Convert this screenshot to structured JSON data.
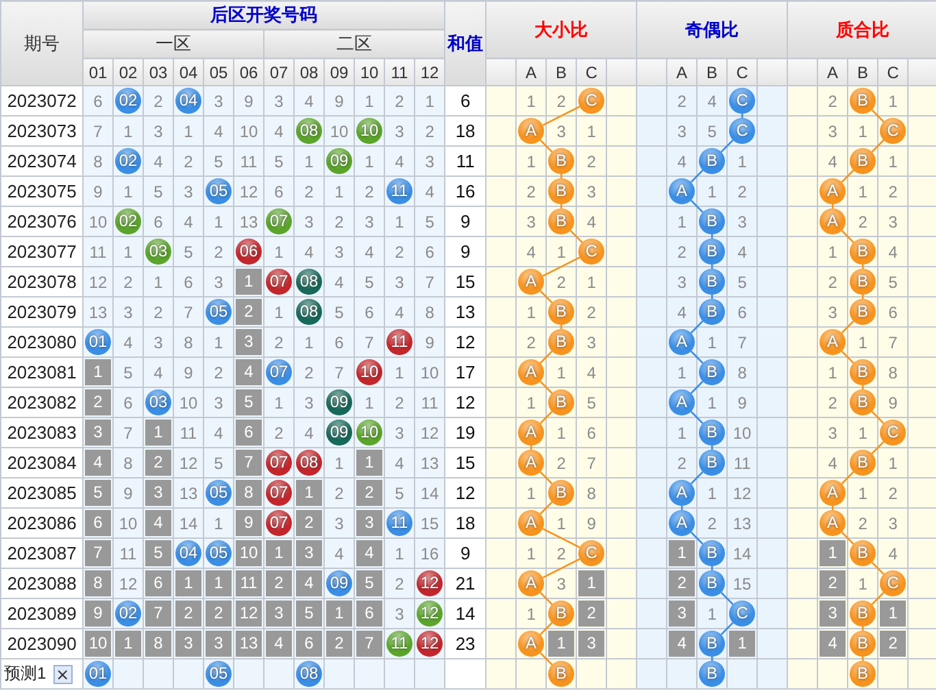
{
  "header": {
    "period": "期号",
    "group": "后区开奖号码",
    "zones": [
      {
        "label": "一区"
      },
      {
        "label": "二区"
      }
    ],
    "columns": [
      "01",
      "02",
      "03",
      "04",
      "05",
      "06",
      "07",
      "08",
      "09",
      "10",
      "11",
      "12"
    ],
    "sum": "和值"
  },
  "sections": [
    {
      "title": "大小比",
      "color": "#f7931e",
      "columns": [
        "A",
        "B",
        "C"
      ]
    },
    {
      "title": "奇偶比",
      "color": "#3a8ee6",
      "columns": [
        "A",
        "B",
        "C"
      ]
    },
    {
      "title": "质合比",
      "color": "#f7931e",
      "columns": [
        "A",
        "B",
        "C"
      ]
    }
  ],
  "rows": [
    {
      "period": "2023072",
      "cells": [
        {
          "kind": "miss",
          "text": "6"
        },
        {
          "kind": "ball",
          "text": "02",
          "color": "#3a8ee6"
        },
        {
          "kind": "miss",
          "text": "2"
        },
        {
          "kind": "ball",
          "text": "04",
          "color": "#3a8ee6"
        },
        {
          "kind": "miss",
          "text": "3"
        },
        {
          "kind": "miss",
          "text": "9"
        },
        {
          "kind": "miss",
          "text": "3"
        },
        {
          "kind": "miss",
          "text": "4"
        },
        {
          "kind": "miss",
          "text": "9"
        },
        {
          "kind": "miss",
          "text": "1"
        },
        {
          "kind": "miss",
          "text": "2"
        },
        {
          "kind": "miss",
          "text": "1"
        }
      ],
      "sum": "6",
      "ratios": [
        [
          {
            "kind": "miss",
            "text": "1"
          },
          {
            "kind": "miss",
            "text": "2"
          },
          {
            "kind": "ball",
            "text": "C"
          }
        ],
        [
          {
            "kind": "miss",
            "text": "2"
          },
          {
            "kind": "miss",
            "text": "4"
          },
          {
            "kind": "ball",
            "text": "C"
          }
        ],
        [
          {
            "kind": "miss",
            "text": "2"
          },
          {
            "kind": "ball",
            "text": "B"
          },
          {
            "kind": "miss",
            "text": "1"
          }
        ]
      ]
    },
    {
      "period": "2023073",
      "cells": [
        {
          "kind": "miss",
          "text": "7"
        },
        {
          "kind": "miss",
          "text": "1"
        },
        {
          "kind": "miss",
          "text": "3"
        },
        {
          "kind": "miss",
          "text": "1"
        },
        {
          "kind": "miss",
          "text": "4"
        },
        {
          "kind": "miss",
          "text": "10"
        },
        {
          "kind": "miss",
          "text": "4"
        },
        {
          "kind": "ball",
          "text": "08",
          "color": "#5ba52b"
        },
        {
          "kind": "miss",
          "text": "10"
        },
        {
          "kind": "ball",
          "text": "10",
          "color": "#5ba52b"
        },
        {
          "kind": "miss",
          "text": "3"
        },
        {
          "kind": "miss",
          "text": "2"
        }
      ],
      "sum": "18",
      "ratios": [
        [
          {
            "kind": "ball",
            "text": "A"
          },
          {
            "kind": "miss",
            "text": "3"
          },
          {
            "kind": "miss",
            "text": "1"
          }
        ],
        [
          {
            "kind": "miss",
            "text": "3"
          },
          {
            "kind": "miss",
            "text": "5"
          },
          {
            "kind": "ball",
            "text": "C"
          }
        ],
        [
          {
            "kind": "miss",
            "text": "3"
          },
          {
            "kind": "miss",
            "text": "1"
          },
          {
            "kind": "ball",
            "text": "C"
          }
        ]
      ]
    },
    {
      "period": "2023074",
      "cells": [
        {
          "kind": "miss",
          "text": "8"
        },
        {
          "kind": "ball",
          "text": "02",
          "color": "#3a8ee6"
        },
        {
          "kind": "miss",
          "text": "4"
        },
        {
          "kind": "miss",
          "text": "2"
        },
        {
          "kind": "miss",
          "text": "5"
        },
        {
          "kind": "miss",
          "text": "11"
        },
        {
          "kind": "miss",
          "text": "5"
        },
        {
          "kind": "miss",
          "text": "1"
        },
        {
          "kind": "ball",
          "text": "09",
          "color": "#5ba52b"
        },
        {
          "kind": "miss",
          "text": "1"
        },
        {
          "kind": "miss",
          "text": "4"
        },
        {
          "kind": "miss",
          "text": "3"
        }
      ],
      "sum": "11",
      "ratios": [
        [
          {
            "kind": "miss",
            "text": "1"
          },
          {
            "kind": "ball",
            "text": "B"
          },
          {
            "kind": "miss",
            "text": "2"
          }
        ],
        [
          {
            "kind": "miss",
            "text": "4"
          },
          {
            "kind": "ball",
            "text": "B"
          },
          {
            "kind": "miss",
            "text": "1"
          }
        ],
        [
          {
            "kind": "miss",
            "text": "4"
          },
          {
            "kind": "ball",
            "text": "B"
          },
          {
            "kind": "miss",
            "text": "1"
          }
        ]
      ]
    },
    {
      "period": "2023075",
      "cells": [
        {
          "kind": "miss",
          "text": "9"
        },
        {
          "kind": "miss",
          "text": "1"
        },
        {
          "kind": "miss",
          "text": "5"
        },
        {
          "kind": "miss",
          "text": "3"
        },
        {
          "kind": "ball",
          "text": "05",
          "color": "#3a8ee6"
        },
        {
          "kind": "miss",
          "text": "12"
        },
        {
          "kind": "miss",
          "text": "6"
        },
        {
          "kind": "miss",
          "text": "2"
        },
        {
          "kind": "miss",
          "text": "1"
        },
        {
          "kind": "miss",
          "text": "2"
        },
        {
          "kind": "ball",
          "text": "11",
          "color": "#3a8ee6"
        },
        {
          "kind": "miss",
          "text": "4"
        }
      ],
      "sum": "16",
      "ratios": [
        [
          {
            "kind": "miss",
            "text": "2"
          },
          {
            "kind": "ball",
            "text": "B"
          },
          {
            "kind": "miss",
            "text": "3"
          }
        ],
        [
          {
            "kind": "ball",
            "text": "A"
          },
          {
            "kind": "miss",
            "text": "1"
          },
          {
            "kind": "miss",
            "text": "2"
          }
        ],
        [
          {
            "kind": "ball",
            "text": "A"
          },
          {
            "kind": "miss",
            "text": "1"
          },
          {
            "kind": "miss",
            "text": "2"
          }
        ]
      ]
    },
    {
      "period": "2023076",
      "cells": [
        {
          "kind": "miss",
          "text": "10"
        },
        {
          "kind": "ball",
          "text": "02",
          "color": "#5ba52b"
        },
        {
          "kind": "miss",
          "text": "6"
        },
        {
          "kind": "miss",
          "text": "4"
        },
        {
          "kind": "miss",
          "text": "1"
        },
        {
          "kind": "miss",
          "text": "13"
        },
        {
          "kind": "ball",
          "text": "07",
          "color": "#5ba52b"
        },
        {
          "kind": "miss",
          "text": "3"
        },
        {
          "kind": "miss",
          "text": "2"
        },
        {
          "kind": "miss",
          "text": "3"
        },
        {
          "kind": "miss",
          "text": "1"
        },
        {
          "kind": "miss",
          "text": "5"
        }
      ],
      "sum": "9",
      "ratios": [
        [
          {
            "kind": "miss",
            "text": "3"
          },
          {
            "kind": "ball",
            "text": "B"
          },
          {
            "kind": "miss",
            "text": "4"
          }
        ],
        [
          {
            "kind": "miss",
            "text": "1"
          },
          {
            "kind": "ball",
            "text": "B"
          },
          {
            "kind": "miss",
            "text": "3"
          }
        ],
        [
          {
            "kind": "ball",
            "text": "A"
          },
          {
            "kind": "miss",
            "text": "2"
          },
          {
            "kind": "miss",
            "text": "3"
          }
        ]
      ]
    },
    {
      "period": "2023077",
      "cells": [
        {
          "kind": "miss",
          "text": "11"
        },
        {
          "kind": "miss",
          "text": "1"
        },
        {
          "kind": "ball",
          "text": "03",
          "color": "#5ba52b"
        },
        {
          "kind": "miss",
          "text": "5"
        },
        {
          "kind": "miss",
          "text": "2"
        },
        {
          "kind": "ball",
          "text": "06",
          "color": "#c4262b"
        },
        {
          "kind": "miss",
          "text": "1"
        },
        {
          "kind": "miss",
          "text": "4"
        },
        {
          "kind": "miss",
          "text": "3"
        },
        {
          "kind": "miss",
          "text": "4"
        },
        {
          "kind": "miss",
          "text": "2"
        },
        {
          "kind": "miss",
          "text": "6"
        }
      ],
      "sum": "9",
      "ratios": [
        [
          {
            "kind": "miss",
            "text": "4"
          },
          {
            "kind": "miss",
            "text": "1"
          },
          {
            "kind": "ball",
            "text": "C"
          }
        ],
        [
          {
            "kind": "miss",
            "text": "2"
          },
          {
            "kind": "ball",
            "text": "B"
          },
          {
            "kind": "miss",
            "text": "4"
          }
        ],
        [
          {
            "kind": "miss",
            "text": "1"
          },
          {
            "kind": "ball",
            "text": "B"
          },
          {
            "kind": "miss",
            "text": "4"
          }
        ]
      ]
    },
    {
      "period": "2023078",
      "cells": [
        {
          "kind": "miss",
          "text": "12"
        },
        {
          "kind": "miss",
          "text": "2"
        },
        {
          "kind": "miss",
          "text": "1"
        },
        {
          "kind": "miss",
          "text": "6"
        },
        {
          "kind": "miss",
          "text": "3"
        },
        {
          "kind": "block",
          "text": "1"
        },
        {
          "kind": "ball",
          "text": "07",
          "color": "#c4262b"
        },
        {
          "kind": "ball",
          "text": "08",
          "color": "#17695a"
        },
        {
          "kind": "miss",
          "text": "4"
        },
        {
          "kind": "miss",
          "text": "5"
        },
        {
          "kind": "miss",
          "text": "3"
        },
        {
          "kind": "miss",
          "text": "7"
        }
      ],
      "sum": "15",
      "ratios": [
        [
          {
            "kind": "ball",
            "text": "A"
          },
          {
            "kind": "miss",
            "text": "2"
          },
          {
            "kind": "miss",
            "text": "1"
          }
        ],
        [
          {
            "kind": "miss",
            "text": "3"
          },
          {
            "kind": "ball",
            "text": "B"
          },
          {
            "kind": "miss",
            "text": "5"
          }
        ],
        [
          {
            "kind": "miss",
            "text": "2"
          },
          {
            "kind": "ball",
            "text": "B"
          },
          {
            "kind": "miss",
            "text": "5"
          }
        ]
      ]
    },
    {
      "period": "2023079",
      "cells": [
        {
          "kind": "miss",
          "text": "13"
        },
        {
          "kind": "miss",
          "text": "3"
        },
        {
          "kind": "miss",
          "text": "2"
        },
        {
          "kind": "miss",
          "text": "7"
        },
        {
          "kind": "ball",
          "text": "05",
          "color": "#3a8ee6"
        },
        {
          "kind": "block",
          "text": "2"
        },
        {
          "kind": "miss",
          "text": "1"
        },
        {
          "kind": "ball",
          "text": "08",
          "color": "#17695a"
        },
        {
          "kind": "miss",
          "text": "5"
        },
        {
          "kind": "miss",
          "text": "6"
        },
        {
          "kind": "miss",
          "text": "4"
        },
        {
          "kind": "miss",
          "text": "8"
        }
      ],
      "sum": "13",
      "ratios": [
        [
          {
            "kind": "miss",
            "text": "1"
          },
          {
            "kind": "ball",
            "text": "B"
          },
          {
            "kind": "miss",
            "text": "2"
          }
        ],
        [
          {
            "kind": "miss",
            "text": "4"
          },
          {
            "kind": "ball",
            "text": "B"
          },
          {
            "kind": "miss",
            "text": "6"
          }
        ],
        [
          {
            "kind": "miss",
            "text": "3"
          },
          {
            "kind": "ball",
            "text": "B"
          },
          {
            "kind": "miss",
            "text": "6"
          }
        ]
      ]
    },
    {
      "period": "2023080",
      "cells": [
        {
          "kind": "ball",
          "text": "01",
          "color": "#3a8ee6"
        },
        {
          "kind": "miss",
          "text": "4"
        },
        {
          "kind": "miss",
          "text": "3"
        },
        {
          "kind": "miss",
          "text": "8"
        },
        {
          "kind": "miss",
          "text": "1"
        },
        {
          "kind": "block",
          "text": "3"
        },
        {
          "kind": "miss",
          "text": "2"
        },
        {
          "kind": "miss",
          "text": "1"
        },
        {
          "kind": "miss",
          "text": "6"
        },
        {
          "kind": "miss",
          "text": "7"
        },
        {
          "kind": "ball",
          "text": "11",
          "color": "#c4262b"
        },
        {
          "kind": "miss",
          "text": "9"
        }
      ],
      "sum": "12",
      "ratios": [
        [
          {
            "kind": "miss",
            "text": "2"
          },
          {
            "kind": "ball",
            "text": "B"
          },
          {
            "kind": "miss",
            "text": "3"
          }
        ],
        [
          {
            "kind": "ball",
            "text": "A"
          },
          {
            "kind": "miss",
            "text": "1"
          },
          {
            "kind": "miss",
            "text": "7"
          }
        ],
        [
          {
            "kind": "ball",
            "text": "A"
          },
          {
            "kind": "miss",
            "text": "1"
          },
          {
            "kind": "miss",
            "text": "7"
          }
        ]
      ]
    },
    {
      "period": "2023081",
      "cells": [
        {
          "kind": "block",
          "text": "1"
        },
        {
          "kind": "miss",
          "text": "5"
        },
        {
          "kind": "miss",
          "text": "4"
        },
        {
          "kind": "miss",
          "text": "9"
        },
        {
          "kind": "miss",
          "text": "2"
        },
        {
          "kind": "block",
          "text": "4"
        },
        {
          "kind": "ball",
          "text": "07",
          "color": "#3a8ee6"
        },
        {
          "kind": "miss",
          "text": "2"
        },
        {
          "kind": "miss",
          "text": "7"
        },
        {
          "kind": "ball",
          "text": "10",
          "color": "#c4262b"
        },
        {
          "kind": "miss",
          "text": "1"
        },
        {
          "kind": "miss",
          "text": "10"
        }
      ],
      "sum": "17",
      "ratios": [
        [
          {
            "kind": "ball",
            "text": "A"
          },
          {
            "kind": "miss",
            "text": "1"
          },
          {
            "kind": "miss",
            "text": "4"
          }
        ],
        [
          {
            "kind": "miss",
            "text": "1"
          },
          {
            "kind": "ball",
            "text": "B"
          },
          {
            "kind": "miss",
            "text": "8"
          }
        ],
        [
          {
            "kind": "miss",
            "text": "1"
          },
          {
            "kind": "ball",
            "text": "B"
          },
          {
            "kind": "miss",
            "text": "8"
          }
        ]
      ]
    },
    {
      "period": "2023082",
      "cells": [
        {
          "kind": "block",
          "text": "2"
        },
        {
          "kind": "miss",
          "text": "6"
        },
        {
          "kind": "ball",
          "text": "03",
          "color": "#3a8ee6"
        },
        {
          "kind": "miss",
          "text": "10"
        },
        {
          "kind": "miss",
          "text": "3"
        },
        {
          "kind": "block",
          "text": "5"
        },
        {
          "kind": "miss",
          "text": "1"
        },
        {
          "kind": "miss",
          "text": "3"
        },
        {
          "kind": "ball",
          "text": "09",
          "color": "#17695a"
        },
        {
          "kind": "miss",
          "text": "1"
        },
        {
          "kind": "miss",
          "text": "2"
        },
        {
          "kind": "miss",
          "text": "11"
        }
      ],
      "sum": "12",
      "ratios": [
        [
          {
            "kind": "miss",
            "text": "1"
          },
          {
            "kind": "ball",
            "text": "B"
          },
          {
            "kind": "miss",
            "text": "5"
          }
        ],
        [
          {
            "kind": "ball",
            "text": "A"
          },
          {
            "kind": "miss",
            "text": "1"
          },
          {
            "kind": "miss",
            "text": "9"
          }
        ],
        [
          {
            "kind": "miss",
            "text": "2"
          },
          {
            "kind": "ball",
            "text": "B"
          },
          {
            "kind": "miss",
            "text": "9"
          }
        ]
      ]
    },
    {
      "period": "2023083",
      "cells": [
        {
          "kind": "block",
          "text": "3"
        },
        {
          "kind": "miss",
          "text": "7"
        },
        {
          "kind": "block",
          "text": "1"
        },
        {
          "kind": "miss",
          "text": "11"
        },
        {
          "kind": "miss",
          "text": "4"
        },
        {
          "kind": "block",
          "text": "6"
        },
        {
          "kind": "miss",
          "text": "2"
        },
        {
          "kind": "miss",
          "text": "4"
        },
        {
          "kind": "ball",
          "text": "09",
          "color": "#17695a"
        },
        {
          "kind": "ball",
          "text": "10",
          "color": "#5ba52b"
        },
        {
          "kind": "miss",
          "text": "3"
        },
        {
          "kind": "miss",
          "text": "12"
        }
      ],
      "sum": "19",
      "ratios": [
        [
          {
            "kind": "ball",
            "text": "A"
          },
          {
            "kind": "miss",
            "text": "1"
          },
          {
            "kind": "miss",
            "text": "6"
          }
        ],
        [
          {
            "kind": "miss",
            "text": "1"
          },
          {
            "kind": "ball",
            "text": "B"
          },
          {
            "kind": "miss",
            "text": "10"
          }
        ],
        [
          {
            "kind": "miss",
            "text": "3"
          },
          {
            "kind": "miss",
            "text": "1"
          },
          {
            "kind": "ball",
            "text": "C"
          }
        ]
      ]
    },
    {
      "period": "2023084",
      "cells": [
        {
          "kind": "block",
          "text": "4"
        },
        {
          "kind": "miss",
          "text": "8"
        },
        {
          "kind": "block",
          "text": "2"
        },
        {
          "kind": "miss",
          "text": "12"
        },
        {
          "kind": "miss",
          "text": "5"
        },
        {
          "kind": "block",
          "text": "7"
        },
        {
          "kind": "ball",
          "text": "07",
          "color": "#c4262b"
        },
        {
          "kind": "ball",
          "text": "08",
          "color": "#c4262b"
        },
        {
          "kind": "miss",
          "text": "1"
        },
        {
          "kind": "block",
          "text": "1"
        },
        {
          "kind": "miss",
          "text": "4"
        },
        {
          "kind": "miss",
          "text": "13"
        }
      ],
      "sum": "15",
      "ratios": [
        [
          {
            "kind": "ball",
            "text": "A"
          },
          {
            "kind": "miss",
            "text": "2"
          },
          {
            "kind": "miss",
            "text": "7"
          }
        ],
        [
          {
            "kind": "miss",
            "text": "2"
          },
          {
            "kind": "ball",
            "text": "B"
          },
          {
            "kind": "miss",
            "text": "11"
          }
        ],
        [
          {
            "kind": "miss",
            "text": "4"
          },
          {
            "kind": "ball",
            "text": "B"
          },
          {
            "kind": "miss",
            "text": "1"
          }
        ]
      ]
    },
    {
      "period": "2023085",
      "cells": [
        {
          "kind": "block",
          "text": "5"
        },
        {
          "kind": "miss",
          "text": "9"
        },
        {
          "kind": "block",
          "text": "3"
        },
        {
          "kind": "miss",
          "text": "13"
        },
        {
          "kind": "ball",
          "text": "05",
          "color": "#3a8ee6"
        },
        {
          "kind": "block",
          "text": "8"
        },
        {
          "kind": "ball",
          "text": "07",
          "color": "#c4262b"
        },
        {
          "kind": "block",
          "text": "1"
        },
        {
          "kind": "miss",
          "text": "2"
        },
        {
          "kind": "block",
          "text": "2"
        },
        {
          "kind": "miss",
          "text": "5"
        },
        {
          "kind": "miss",
          "text": "14"
        }
      ],
      "sum": "12",
      "ratios": [
        [
          {
            "kind": "miss",
            "text": "1"
          },
          {
            "kind": "ball",
            "text": "B"
          },
          {
            "kind": "miss",
            "text": "8"
          }
        ],
        [
          {
            "kind": "ball",
            "text": "A"
          },
          {
            "kind": "miss",
            "text": "1"
          },
          {
            "kind": "miss",
            "text": "12"
          }
        ],
        [
          {
            "kind": "ball",
            "text": "A"
          },
          {
            "kind": "miss",
            "text": "1"
          },
          {
            "kind": "miss",
            "text": "2"
          }
        ]
      ]
    },
    {
      "period": "2023086",
      "cells": [
        {
          "kind": "block",
          "text": "6"
        },
        {
          "kind": "miss",
          "text": "10"
        },
        {
          "kind": "block",
          "text": "4"
        },
        {
          "kind": "miss",
          "text": "14"
        },
        {
          "kind": "miss",
          "text": "1"
        },
        {
          "kind": "block",
          "text": "9"
        },
        {
          "kind": "ball",
          "text": "07",
          "color": "#c4262b"
        },
        {
          "kind": "block",
          "text": "2"
        },
        {
          "kind": "miss",
          "text": "3"
        },
        {
          "kind": "block",
          "text": "3"
        },
        {
          "kind": "ball",
          "text": "11",
          "color": "#3a8ee6"
        },
        {
          "kind": "miss",
          "text": "15"
        }
      ],
      "sum": "18",
      "ratios": [
        [
          {
            "kind": "ball",
            "text": "A"
          },
          {
            "kind": "miss",
            "text": "1"
          },
          {
            "kind": "miss",
            "text": "9"
          }
        ],
        [
          {
            "kind": "ball",
            "text": "A"
          },
          {
            "kind": "miss",
            "text": "2"
          },
          {
            "kind": "miss",
            "text": "13"
          }
        ],
        [
          {
            "kind": "ball",
            "text": "A"
          },
          {
            "kind": "miss",
            "text": "2"
          },
          {
            "kind": "miss",
            "text": "3"
          }
        ]
      ]
    },
    {
      "period": "2023087",
      "cells": [
        {
          "kind": "block",
          "text": "7"
        },
        {
          "kind": "miss",
          "text": "11"
        },
        {
          "kind": "block",
          "text": "5"
        },
        {
          "kind": "ball",
          "text": "04",
          "color": "#3a8ee6"
        },
        {
          "kind": "ball",
          "text": "05",
          "color": "#3a8ee6"
        },
        {
          "kind": "block",
          "text": "10"
        },
        {
          "kind": "block",
          "text": "1"
        },
        {
          "kind": "block",
          "text": "3"
        },
        {
          "kind": "miss",
          "text": "4"
        },
        {
          "kind": "block",
          "text": "4"
        },
        {
          "kind": "miss",
          "text": "1"
        },
        {
          "kind": "miss",
          "text": "16"
        }
      ],
      "sum": "9",
      "ratios": [
        [
          {
            "kind": "miss",
            "text": "1"
          },
          {
            "kind": "miss",
            "text": "2"
          },
          {
            "kind": "ball",
            "text": "C"
          }
        ],
        [
          {
            "kind": "block",
            "text": "1"
          },
          {
            "kind": "ball",
            "text": "B"
          },
          {
            "kind": "miss",
            "text": "14"
          }
        ],
        [
          {
            "kind": "block",
            "text": "1"
          },
          {
            "kind": "ball",
            "text": "B"
          },
          {
            "kind": "miss",
            "text": "4"
          }
        ]
      ]
    },
    {
      "period": "2023088",
      "cells": [
        {
          "kind": "block",
          "text": "8"
        },
        {
          "kind": "miss",
          "text": "12"
        },
        {
          "kind": "block",
          "text": "6"
        },
        {
          "kind": "block",
          "text": "1"
        },
        {
          "kind": "block",
          "text": "1"
        },
        {
          "kind": "block",
          "text": "11"
        },
        {
          "kind": "block",
          "text": "2"
        },
        {
          "kind": "block",
          "text": "4"
        },
        {
          "kind": "ball",
          "text": "09",
          "color": "#3a8ee6"
        },
        {
          "kind": "block",
          "text": "5"
        },
        {
          "kind": "miss",
          "text": "2"
        },
        {
          "kind": "ball",
          "text": "12",
          "color": "#c4262b"
        }
      ],
      "sum": "21",
      "ratios": [
        [
          {
            "kind": "ball",
            "text": "A"
          },
          {
            "kind": "miss",
            "text": "3"
          },
          {
            "kind": "block",
            "text": "1"
          }
        ],
        [
          {
            "kind": "block",
            "text": "2"
          },
          {
            "kind": "ball",
            "text": "B"
          },
          {
            "kind": "miss",
            "text": "15"
          }
        ],
        [
          {
            "kind": "block",
            "text": "2"
          },
          {
            "kind": "miss",
            "text": "1"
          },
          {
            "kind": "ball",
            "text": "C"
          }
        ]
      ]
    },
    {
      "period": "2023089",
      "cells": [
        {
          "kind": "block",
          "text": "9"
        },
        {
          "kind": "ball",
          "text": "02",
          "color": "#3a8ee6"
        },
        {
          "kind": "block",
          "text": "7"
        },
        {
          "kind": "block",
          "text": "2"
        },
        {
          "kind": "block",
          "text": "2"
        },
        {
          "kind": "block",
          "text": "12"
        },
        {
          "kind": "block",
          "text": "3"
        },
        {
          "kind": "block",
          "text": "5"
        },
        {
          "kind": "block",
          "text": "1"
        },
        {
          "kind": "block",
          "text": "6"
        },
        {
          "kind": "miss",
          "text": "3"
        },
        {
          "kind": "ball",
          "text": "12",
          "color": "#5ba52b"
        }
      ],
      "sum": "14",
      "ratios": [
        [
          {
            "kind": "miss",
            "text": "1"
          },
          {
            "kind": "ball",
            "text": "B"
          },
          {
            "kind": "block",
            "text": "2"
          }
        ],
        [
          {
            "kind": "block",
            "text": "3"
          },
          {
            "kind": "miss",
            "text": "1"
          },
          {
            "kind": "ball",
            "text": "C"
          }
        ],
        [
          {
            "kind": "block",
            "text": "3"
          },
          {
            "kind": "ball",
            "text": "B"
          },
          {
            "kind": "block",
            "text": "1"
          }
        ]
      ]
    },
    {
      "period": "2023090",
      "cells": [
        {
          "kind": "block",
          "text": "10"
        },
        {
          "kind": "block",
          "text": "1"
        },
        {
          "kind": "block",
          "text": "8"
        },
        {
          "kind": "block",
          "text": "3"
        },
        {
          "kind": "block",
          "text": "3"
        },
        {
          "kind": "block",
          "text": "13"
        },
        {
          "kind": "block",
          "text": "4"
        },
        {
          "kind": "block",
          "text": "6"
        },
        {
          "kind": "block",
          "text": "2"
        },
        {
          "kind": "block",
          "text": "7"
        },
        {
          "kind": "ball",
          "text": "11",
          "color": "#5ba52b"
        },
        {
          "kind": "ball",
          "text": "12",
          "color": "#c4262b"
        }
      ],
      "sum": "23",
      "ratios": [
        [
          {
            "kind": "ball",
            "text": "A"
          },
          {
            "kind": "block",
            "text": "1"
          },
          {
            "kind": "block",
            "text": "3"
          }
        ],
        [
          {
            "kind": "block",
            "text": "4"
          },
          {
            "kind": "ball",
            "text": "B"
          },
          {
            "kind": "block",
            "text": "1"
          }
        ],
        [
          {
            "kind": "block",
            "text": "4"
          },
          {
            "kind": "ball",
            "text": "B"
          },
          {
            "kind": "block",
            "text": "2"
          }
        ]
      ]
    }
  ],
  "prediction": {
    "label": "预测1",
    "close": "×",
    "cells": [
      {
        "kind": "ball",
        "text": "01",
        "color": "#3a8ee6"
      },
      {
        "kind": "empty"
      },
      {
        "kind": "empty"
      },
      {
        "kind": "empty"
      },
      {
        "kind": "ball",
        "text": "05",
        "color": "#3a8ee6"
      },
      {
        "kind": "empty"
      },
      {
        "kind": "empty"
      },
      {
        "kind": "ball",
        "text": "08",
        "color": "#3a8ee6"
      },
      {
        "kind": "empty"
      },
      {
        "kind": "empty"
      },
      {
        "kind": "empty"
      },
      {
        "kind": "empty"
      }
    ],
    "ratios": [
      [
        {
          "kind": "empty"
        },
        {
          "kind": "ball",
          "text": "B"
        },
        {
          "kind": "empty"
        }
      ],
      [
        {
          "kind": "empty"
        },
        {
          "kind": "ball",
          "text": "B"
        },
        {
          "kind": "empty"
        }
      ],
      [
        {
          "kind": "empty"
        },
        {
          "kind": "ball",
          "text": "B"
        },
        {
          "kind": "empty"
        }
      ]
    ]
  }
}
